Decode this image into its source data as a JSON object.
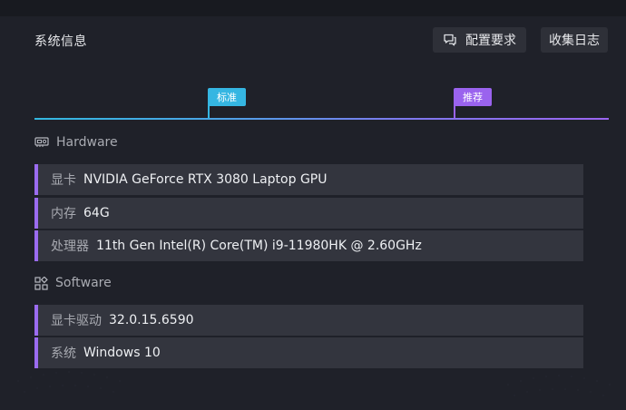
{
  "header": {
    "title": "系统信息",
    "requirements_label": "配置要求",
    "log_label": "收集日志"
  },
  "tier_markers": {
    "standard": "标准",
    "recommended": "推荐"
  },
  "hardware": {
    "heading": "Hardware",
    "rows": [
      {
        "key": "显卡",
        "value": "NVIDIA GeForce RTX 3080 Laptop GPU"
      },
      {
        "key": "内存",
        "value": "64G"
      },
      {
        "key": "处理器",
        "value": "11th Gen Intel(R) Core(TM) i9-11980HK @ 2.60GHz"
      }
    ]
  },
  "software": {
    "heading": "Software",
    "rows": [
      {
        "key": "显卡驱动",
        "value": "32.0.15.6590"
      },
      {
        "key": "系统",
        "value": "Windows 10"
      }
    ]
  },
  "colors": {
    "accent_cyan": "#35b6e2",
    "accent_purple": "#9a63ee",
    "row_bg": "#33353e",
    "panel_bg": "#1f2129"
  }
}
